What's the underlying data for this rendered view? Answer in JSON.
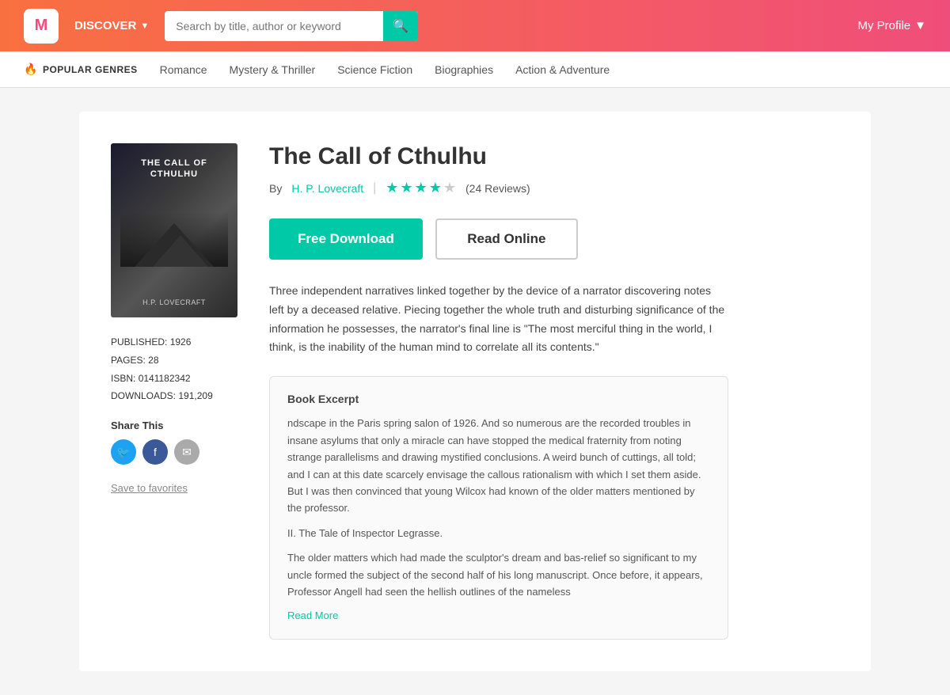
{
  "header": {
    "logo_letter": "M",
    "discover_label": "DISCOVER",
    "search_placeholder": "Search by title, author or keyword",
    "my_profile_label": "My Profile"
  },
  "genres_bar": {
    "label": "POPULAR GENRES",
    "genres": [
      {
        "label": "Romance"
      },
      {
        "label": "Mystery & Thriller"
      },
      {
        "label": "Science Fiction"
      },
      {
        "label": "Biographies"
      },
      {
        "label": "Action & Adventure"
      }
    ]
  },
  "book": {
    "title": "The Call of Cthulhu",
    "by_label": "By",
    "author": "H. P. Lovecraft",
    "reviews_count": "(24 Reviews)",
    "stars": [
      true,
      true,
      true,
      true,
      false
    ],
    "btn_download": "Free Download",
    "btn_read": "Read Online",
    "description": "Three independent narratives linked together by the device of a narrator discovering notes left by a deceased relative. Piecing together the whole truth and disturbing significance of the information he possesses, the narrator's final line is \"The most merciful thing in the world, I think, is the inability of the human mind to correlate all its contents.\"",
    "meta": {
      "published_label": "PUBLISHED:",
      "published_year": "1926",
      "pages_label": "PAGES:",
      "pages_count": "28",
      "isbn_label": "ISBN:",
      "isbn_value": "0141182342",
      "downloads_label": "DOWNLOADS:",
      "downloads_count": "191,209"
    },
    "share_label": "Share This",
    "save_favorites": "Save to favorites",
    "excerpt": {
      "title": "Book Excerpt",
      "text1": "ndscape in the Paris spring salon of 1926. And so numerous are the recorded troubles in insane asylums that only a miracle can have stopped the medical fraternity from noting strange parallelisms and drawing mystified conclusions. A weird bunch of cuttings, all told; and I can at this date scarcely envisage the callous rationalism with which I set them aside. But I was then convinced that young Wilcox had known of the older matters mentioned by the professor.",
      "text2": "II. The Tale of Inspector Legrasse.",
      "text3": "The older matters which had made the sculptor's dream and bas-relief so significant to my uncle formed the subject of the second half of his long manuscript. Once before, it appears, Professor Angell had seen the hellish outlines of the nameless",
      "read_more": "Read More"
    },
    "cover": {
      "title": "THE CALL OF CTHULHU",
      "author": "H.P. LOVECRAFT"
    }
  }
}
